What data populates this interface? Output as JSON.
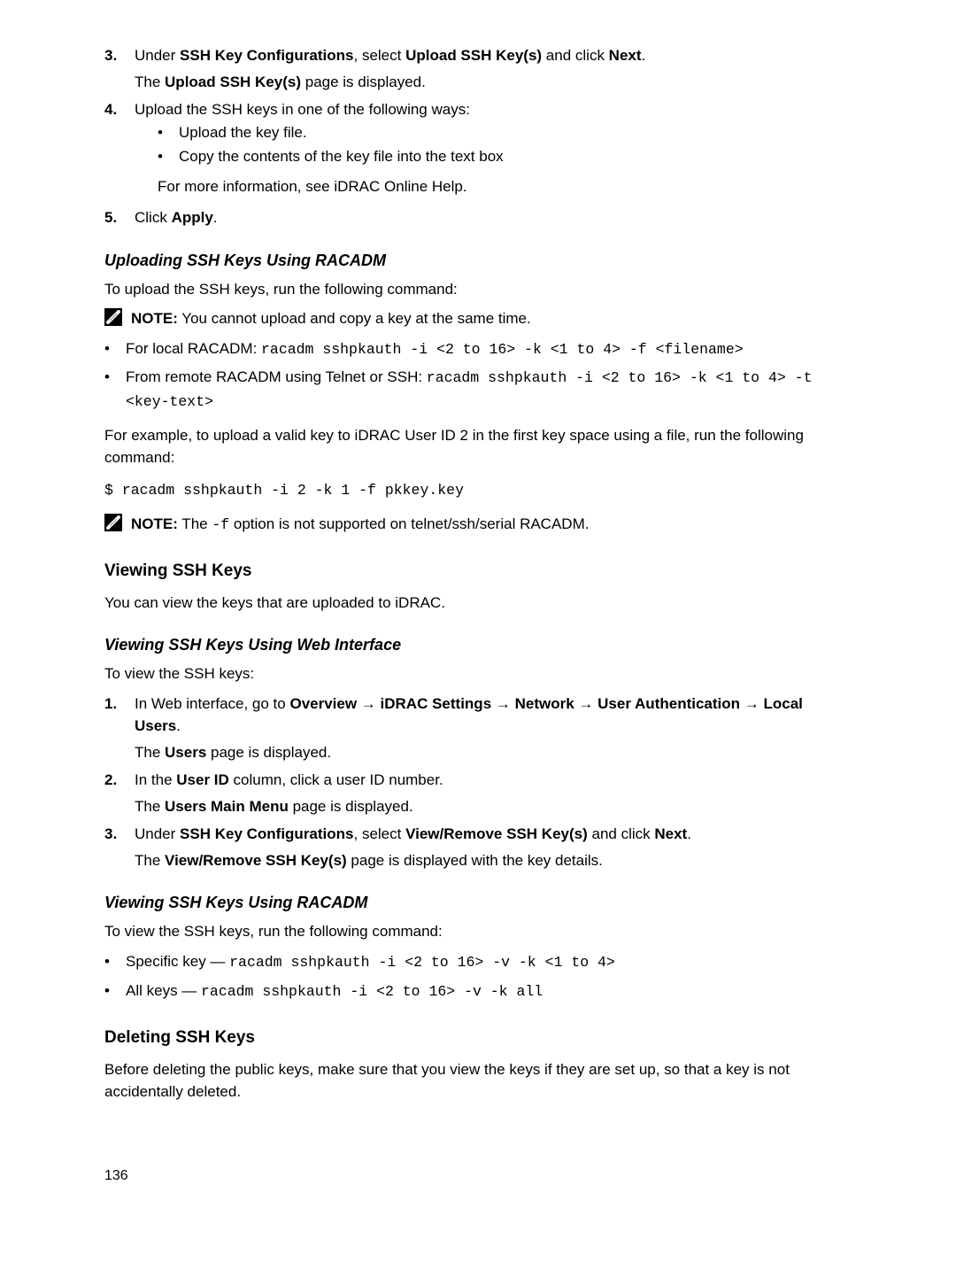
{
  "step3": {
    "line1_pre": "Under ",
    "line1_b1": "SSH Key Configurations",
    "line1_mid": ", select ",
    "line1_b2": "Upload SSH Key(s)",
    "line1_mid2": " and click ",
    "line1_b3": "Next",
    "line1_end": ".",
    "line2_pre": "The ",
    "line2_b": "Upload SSH Key(s)",
    "line2_end": " page is displayed."
  },
  "step4": {
    "intro": "Upload the SSH keys in one of the following ways:",
    "b1": "Upload the key file.",
    "b2": "Copy the contents of the key file into the text box",
    "after": "For more information, see iDRAC Online Help."
  },
  "step5": {
    "pre": "Click ",
    "b": "Apply",
    "end": "."
  },
  "sec_upload_racadm": {
    "title": "Uploading SSH Keys Using RACADM",
    "intro": "To upload the SSH keys, run the following command:",
    "note_label": "NOTE:",
    "note_text": " You cannot upload and copy a key at the same time.",
    "b1_pre": "For local RACADM: ",
    "b1_code": "racadm sshpkauth -i <2 to 16> -k <1 to 4> -f <filename>",
    "b2_pre": "From remote RACADM using Telnet or SSH: ",
    "b2_code": "racadm sshpkauth -i <2 to 16> -k <1 to 4> -t <key-text>",
    "example": "For example, to upload a valid key to iDRAC User ID 2 in the first key space using a file, run the following command:",
    "cmd": "$ racadm sshpkauth -i 2 -k 1 -f pkkey.key",
    "note2_label": "NOTE:",
    "note2_pre": " The ",
    "note2_code": "-f",
    "note2_post": " option is not supported on telnet/ssh/serial RACADM."
  },
  "sec_view": {
    "title": "Viewing SSH Keys",
    "intro": "You can view the keys that are uploaded to iDRAC."
  },
  "sec_view_web": {
    "title": "Viewing SSH Keys Using Web Interface",
    "intro": "To view the SSH keys:",
    "s1_pre": "In Web interface, go to ",
    "s1_b1": "Overview",
    "s1_arrow": " → ",
    "s1_b2": "iDRAC Settings",
    "s1_b3": "Network",
    "s1_b4": "User Authentication",
    "s1_b5": "Local Users",
    "s1_end": ".",
    "s1_line2_pre": "The ",
    "s1_line2_b": "Users",
    "s1_line2_end": " page is displayed.",
    "s2_pre": "In the ",
    "s2_b": "User ID",
    "s2_end": " column, click a user ID number.",
    "s2_line2_pre": "The ",
    "s2_line2_b": "Users Main Menu",
    "s2_line2_end": " page is displayed.",
    "s3_pre": "Under ",
    "s3_b1": "SSH Key Configurations",
    "s3_mid": ", select ",
    "s3_b2": "View/Remove SSH Key(s)",
    "s3_mid2": " and click ",
    "s3_b3": "Next",
    "s3_end": ".",
    "s3_line2_pre": "The ",
    "s3_line2_b": "View/Remove SSH Key(s)",
    "s3_line2_end": " page is displayed with the key details."
  },
  "sec_view_racadm": {
    "title": "Viewing SSH Keys Using RACADM",
    "intro": "To view the SSH keys, run the following command:",
    "b1_pre": "Specific key — ",
    "b1_code": "racadm sshpkauth -i <2 to 16> -v -k <1 to 4>",
    "b2_pre": "All keys — ",
    "b2_code": "racadm sshpkauth -i <2 to 16> -v -k all"
  },
  "sec_delete": {
    "title": "Deleting SSH Keys",
    "intro": "Before deleting the public keys, make sure that you view the keys if they are set up, so that a key is not accidentally deleted."
  },
  "page_num": "136"
}
